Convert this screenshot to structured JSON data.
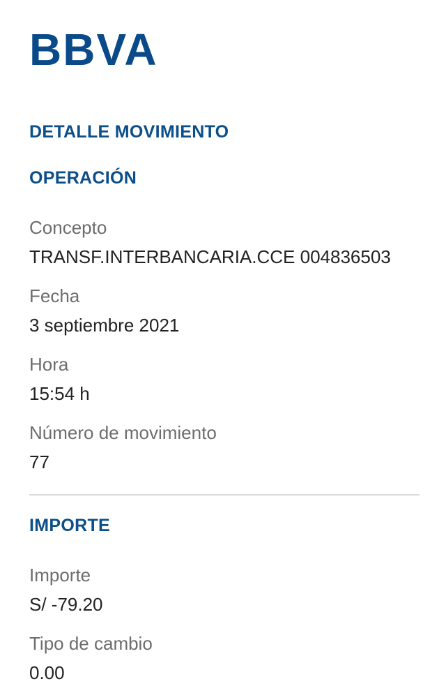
{
  "brand": {
    "logo_text": "BBVA",
    "color": "#0a4a88"
  },
  "page": {
    "title": "DETALLE MOVIMIENTO"
  },
  "operation": {
    "section_title": "OPERACIÓN",
    "fields": [
      {
        "label": "Concepto",
        "value": "TRANSF.INTERBANCARIA.CCE 004836503"
      },
      {
        "label": "Fecha",
        "value": "3 septiembre 2021"
      },
      {
        "label": "Hora",
        "value": "15:54 h"
      },
      {
        "label": "Número de movimiento",
        "value": "77"
      }
    ]
  },
  "amount": {
    "section_title": "IMPORTE",
    "fields": [
      {
        "label": "Importe",
        "value": "S/ -79.20"
      },
      {
        "label": "Tipo de cambio",
        "value": "0.00"
      }
    ]
  }
}
